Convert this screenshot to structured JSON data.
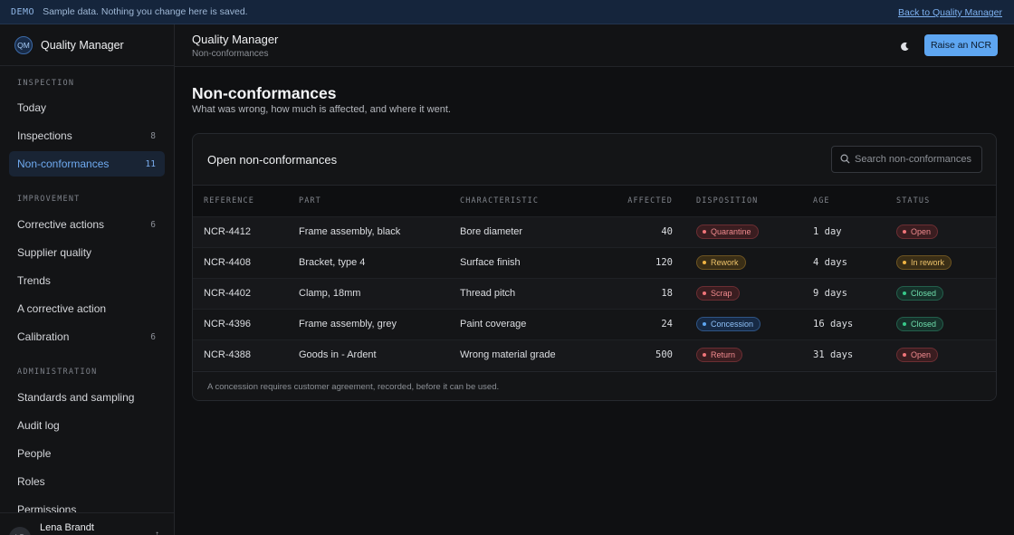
{
  "banner": {
    "tag": "DEMO",
    "message": "Sample data. Nothing you change here is saved.",
    "back_link": "Back to Quality Manager"
  },
  "sidebar": {
    "logo": "QM",
    "app_name": "Quality Manager",
    "sections": [
      {
        "title": "INSPECTION",
        "items": [
          {
            "label": "Today",
            "count": ""
          },
          {
            "label": "Inspections",
            "count": "8"
          },
          {
            "label": "Non-conformances",
            "count": "11",
            "active": true
          }
        ]
      },
      {
        "title": "IMPROVEMENT",
        "items": [
          {
            "label": "Corrective actions",
            "count": "6"
          },
          {
            "label": "Supplier quality",
            "count": ""
          },
          {
            "label": "Trends",
            "count": ""
          },
          {
            "label": "A corrective action",
            "count": ""
          },
          {
            "label": "Calibration",
            "count": "6"
          }
        ]
      },
      {
        "title": "ADMINISTRATION",
        "items": [
          {
            "label": "Standards and sampling",
            "count": ""
          },
          {
            "label": "Audit log",
            "count": ""
          },
          {
            "label": "People",
            "count": ""
          },
          {
            "label": "Roles",
            "count": ""
          },
          {
            "label": "Permissions",
            "count": ""
          }
        ]
      }
    ],
    "user": {
      "initials": "LB",
      "name": "Lena Brandt"
    }
  },
  "topbar": {
    "title": "Quality Manager",
    "breadcrumb": "Non-conformances",
    "theme_icon": "moon-icon",
    "raise_button": "Raise an NCR"
  },
  "page": {
    "title": "Non-conformances",
    "subtitle": "What was wrong, how much is affected, and where it went."
  },
  "card": {
    "title": "Open non-conformances",
    "search_placeholder": "Search non-conformances",
    "columns": [
      "REFERENCE",
      "PART",
      "CHARACTERISTIC",
      "AFFECTED",
      "DISPOSITION",
      "AGE",
      "STATUS"
    ],
    "rows": [
      {
        "reference": "NCR-4412",
        "part": "Frame assembly, black",
        "characteristic": "Bore diameter",
        "affected": "40",
        "disposition": "Quarantine",
        "disposition_color": "red",
        "age": "1 day",
        "status": "Open",
        "status_color": "red"
      },
      {
        "reference": "NCR-4408",
        "part": "Bracket, type 4",
        "characteristic": "Surface finish",
        "affected": "120",
        "disposition": "Rework",
        "disposition_color": "amber",
        "age": "4 days",
        "status": "In rework",
        "status_color": "amber"
      },
      {
        "reference": "NCR-4402",
        "part": "Clamp, 18mm",
        "characteristic": "Thread pitch",
        "affected": "18",
        "disposition": "Scrap",
        "disposition_color": "red",
        "age": "9 days",
        "status": "Closed",
        "status_color": "green"
      },
      {
        "reference": "NCR-4396",
        "part": "Frame assembly, grey",
        "characteristic": "Paint coverage",
        "affected": "24",
        "disposition": "Concession",
        "disposition_color": "blue",
        "age": "16 days",
        "status": "Closed",
        "status_color": "green"
      },
      {
        "reference": "NCR-4388",
        "part": "Goods in - Ardent",
        "characteristic": "Wrong material grade",
        "affected": "500",
        "disposition": "Return",
        "disposition_color": "red",
        "age": "31 days",
        "status": "Open",
        "status_color": "red"
      }
    ],
    "footer_note": "A concession requires customer agreement, recorded, before it can be used."
  }
}
